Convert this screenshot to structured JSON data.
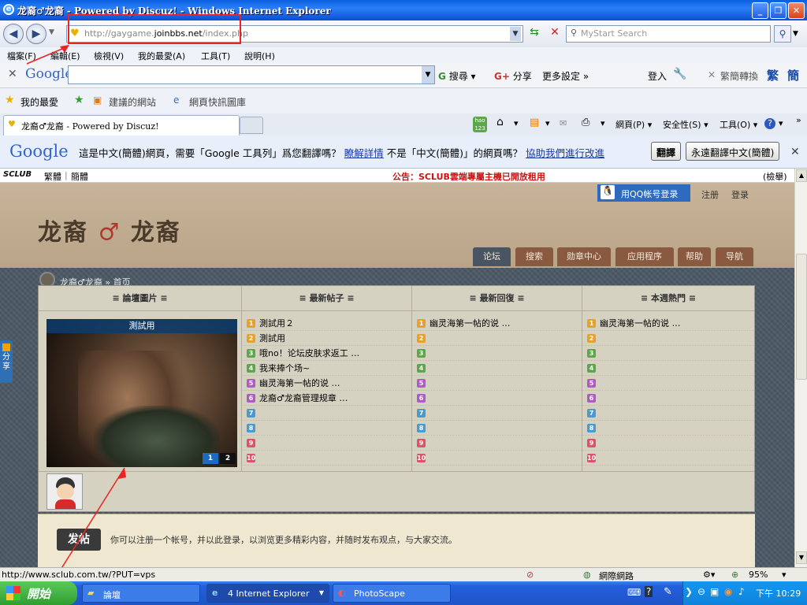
{
  "window": {
    "title": "龙裔♂龙裔 - Powered by Discuz! - Windows Internet Explorer",
    "min": "_",
    "max": "❐",
    "close": "✕"
  },
  "address": {
    "prefix": "http://gaygame.",
    "domain": "joinbbs.net",
    "suffix": "/index.php"
  },
  "search": {
    "placeholder": "MyStart Search"
  },
  "menu": [
    "檔案(F)",
    "編輯(E)",
    "檢視(V)",
    "我的最愛(A)",
    "工具(T)",
    "說明(H)"
  ],
  "google_bar": {
    "logo": "Google",
    "search_btn": "搜尋",
    "share": "分享",
    "more": "更多設定 »",
    "login": "登入",
    "convert": "繁簡轉換",
    "trad": "繁",
    "simp": "簡"
  },
  "fav_bar": {
    "favorites": "我的最愛",
    "suggested": "建議的網站",
    "gallery": "網頁快訊圖庫"
  },
  "tab": {
    "label": "龙裔♂龙裔 - Powered by Discuz!"
  },
  "commands": {
    "page": "網頁(P)",
    "safety": "安全性(S)",
    "tools": "工具(O)"
  },
  "translate": {
    "logo": "Google",
    "msg1": "這是中文(簡體)網頁，需要「Google 工具列」爲您翻譯嗎？",
    "learn": "瞭解詳情",
    "msg2": "不是「中文(簡體)」的網頁嗎？",
    "help": "協助我們進行改進",
    "translate_btn": "翻譯",
    "always_btn": "永遠翻譯中文(簡體)"
  },
  "site": {
    "sclub": "SCLUB",
    "trad": "繁體",
    "simp": "簡體",
    "notice": "公告：SCLUB雲端專屬主機已開放租用",
    "check": "(檢舉)",
    "logo_left": "龙裔",
    "logo_sym": "♂",
    "logo_right": "龙裔",
    "qq_login": "用QQ帐号登录",
    "register": "注册",
    "login": "登录",
    "nav": [
      "论坛",
      "搜索",
      "勋章中心",
      "应用程序",
      "帮助",
      "导航"
    ],
    "breadcrumb": "龙裔♂龙裔 » 首页",
    "cols": [
      {
        "title": "≡ 論壇圖片 ≡"
      },
      {
        "title": "≡ 最新帖子 ≡",
        "items": [
          "測試用２",
          "測試用",
          "哦no！论坛皮肤求返工 …",
          "我来捧个场~",
          "幽灵海第一帖的说 …",
          "龙裔♂龙裔管理规章 …",
          "",
          "",
          "",
          ""
        ]
      },
      {
        "title": "≡ 最新回復 ≡",
        "items": [
          "幽灵海第一帖的说 …",
          "",
          "",
          "",
          "",
          "",
          "",
          "",
          "",
          ""
        ]
      },
      {
        "title": "≡ 本週熱門 ≡",
        "items": [
          "幽灵海第一帖的说 …",
          "",
          "",
          "",
          "",
          "",
          "",
          "",
          "",
          ""
        ]
      }
    ],
    "photo_caption": "測試用",
    "pages": [
      "1",
      "2"
    ],
    "post_btn": "发帖",
    "footer_msg": "你可以注册一个帐号，并以此登录，以浏览更多精彩内容，并随时发布观点，与大家交流。",
    "share_tab": "分享"
  },
  "status": {
    "url": "http://www.sclub.com.tw/?PUT=vps",
    "zone": "網際網路",
    "zoom": "95%"
  },
  "taskbar": {
    "start": "開始",
    "tasks": [
      "論壇",
      "4 Internet Explorer",
      "PhotoScape"
    ],
    "clock": "下午 10:29"
  },
  "colors": {
    "num": [
      "#e8a02a",
      "#e8a02a",
      "#5aa84a",
      "#5aa84a",
      "#b05ac8",
      "#b05ac8",
      "#4a9ad0",
      "#4a9ad0",
      "#e0506a",
      "#e0506a"
    ]
  }
}
